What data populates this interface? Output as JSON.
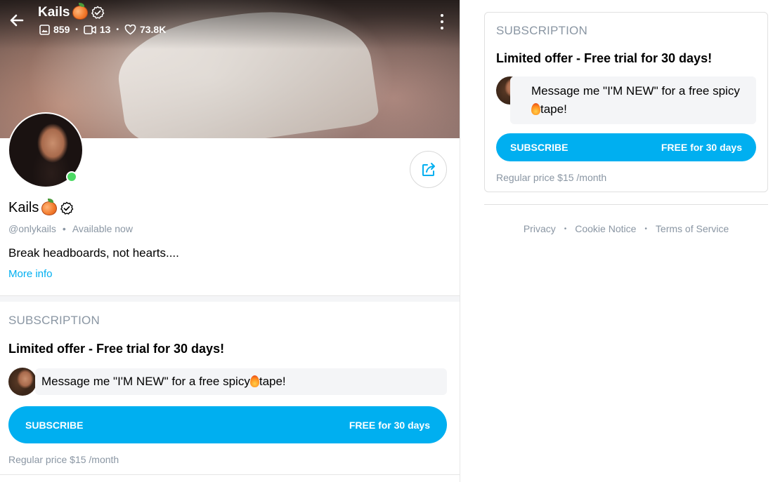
{
  "header": {
    "name": "Kails",
    "stats": {
      "photos": "859",
      "videos": "13",
      "likes": "73.8K"
    }
  },
  "profile": {
    "name": "Kails",
    "handle": "@onlykails",
    "status": "Available now",
    "bio": "Break headboards, not hearts....",
    "more_info": "More info"
  },
  "subscription": {
    "title": "SUBSCRIPTION",
    "offer": "Limited offer - Free trial for 30 days!",
    "message_prefix": "Message me \"I'M NEW\" for a free spicy",
    "message_suffix": "tape!",
    "button_label": "SUBSCRIBE",
    "button_price": "FREE for 30 days",
    "regular_price": "Regular price $15 /month"
  },
  "footer": {
    "links": [
      "Privacy",
      "Cookie Notice",
      "Terms of Service"
    ]
  },
  "colors": {
    "accent": "#00aff0",
    "muted": "#8a96a3",
    "online": "#4cd964"
  },
  "icons": [
    "back-arrow-icon",
    "photo-icon",
    "video-icon",
    "heart-icon",
    "verified-icon",
    "kebab-menu-icon",
    "share-icon",
    "peach-emoji-icon",
    "fire-emoji-icon"
  ]
}
